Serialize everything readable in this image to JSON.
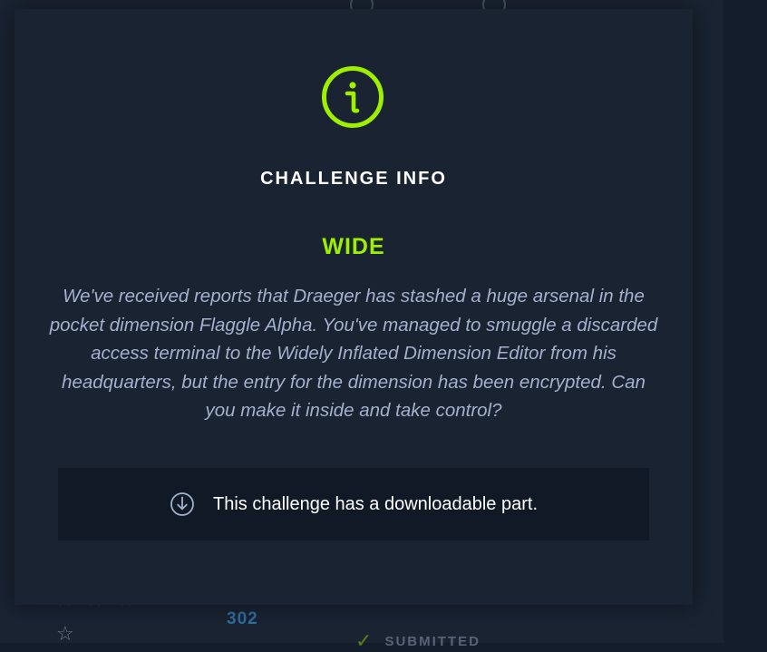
{
  "background": {
    "solves_count": "302",
    "status_label": "SUBMITTED"
  },
  "modal": {
    "title": "CHALLENGE INFO",
    "challenge_name": "WIDE",
    "description": "We've received reports that Draeger has stashed a huge arsenal in the pocket dimension Flaggle Alpha. You've managed to smuggle a discarded access terminal to the Widely Inflated Dimension Editor from his headquarters, but the entry for the dimension has been encrypted. Can you make it inside and take control?",
    "download_text": "This challenge has a downloadable part.",
    "icons": {
      "header": "info-icon",
      "download": "download-icon"
    }
  },
  "colors": {
    "accent": "#9fef00",
    "modal_bg": "#1a2332",
    "download_box_bg": "#111927",
    "description_text": "#a4b1cd",
    "solves_text": "#2e6d9e"
  }
}
